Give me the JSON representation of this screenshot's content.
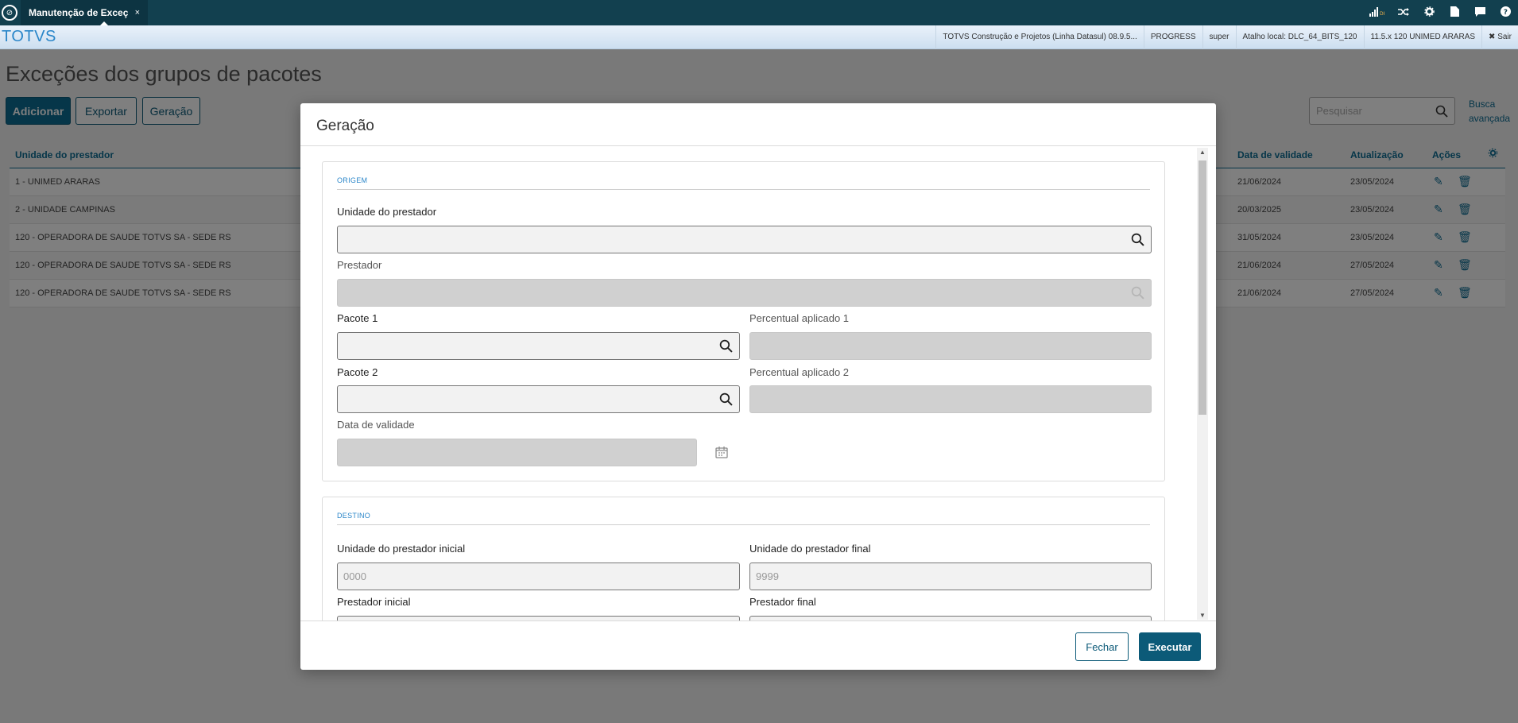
{
  "window": {
    "tab_title": "Manutenção de Exceç",
    "tab_close": "×",
    "icons": [
      "signal-icon",
      "shuffle-icon",
      "gear-icon",
      "document-icon",
      "chat-icon",
      "help-icon"
    ],
    "signal_label": "DI"
  },
  "strip": {
    "brand": "TOTVS",
    "info": [
      "TOTVS Construção e Projetos (Linha Datasul) 08.9.5...",
      "PROGRESS",
      "super",
      "Atalho local: DLC_64_BITS_120",
      "11.5.x 120 UNIMED ARARAS"
    ],
    "logout": "✖ Sair"
  },
  "page": {
    "title": "Exceções dos grupos de pacotes",
    "buttons": {
      "add": "Adicionar",
      "export": "Exportar",
      "generate": "Geração"
    },
    "search_placeholder": "Pesquisar",
    "advanced_search": "Busca avançada",
    "table": {
      "headers": {
        "unit": "Unidade do prestador",
        "validity": "Data de validade",
        "updated": "Atualização",
        "actions": "Ações"
      },
      "rows": [
        {
          "unit": "1 - UNIMED ARARAS",
          "validity": "21/06/2024",
          "updated": "23/05/2024"
        },
        {
          "unit": "2 - UNIDADE CAMPINAS",
          "validity": "20/03/2025",
          "updated": "23/05/2024"
        },
        {
          "unit": "120 - OPERADORA DE SAUDE TOTVS SA - SEDE RS",
          "validity": "31/05/2024",
          "updated": "23/05/2024"
        },
        {
          "unit": "120 - OPERADORA DE SAUDE TOTVS SA - SEDE RS",
          "validity": "21/06/2024",
          "updated": "27/05/2024"
        },
        {
          "unit": "120 - OPERADORA DE SAUDE TOTVS SA - SEDE RS",
          "validity": "21/06/2024",
          "updated": "27/05/2024"
        }
      ]
    }
  },
  "modal": {
    "title": "Geração",
    "origin": {
      "section": "ORIGEM",
      "unit_label": "Unidade do prestador",
      "unit_value": "",
      "provider_label": "Prestador",
      "provider_value": "",
      "package1_label": "Pacote 1",
      "package1_value": "",
      "percent1_label": "Percentual aplicado 1",
      "percent1_value": "",
      "package2_label": "Pacote 2",
      "package2_value": "",
      "percent2_label": "Percentual aplicado 2",
      "percent2_value": "",
      "validity_label": "Data de validade",
      "validity_value": ""
    },
    "destination": {
      "section": "DESTINO",
      "unit_start_label": "Unidade do prestador inicial",
      "unit_start_placeholder": "0000",
      "unit_end_label": "Unidade do prestador final",
      "unit_end_placeholder": "9999",
      "provider_start_label": "Prestador inicial",
      "provider_end_label": "Prestador final"
    },
    "buttons": {
      "close": "Fechar",
      "execute": "Executar"
    }
  }
}
